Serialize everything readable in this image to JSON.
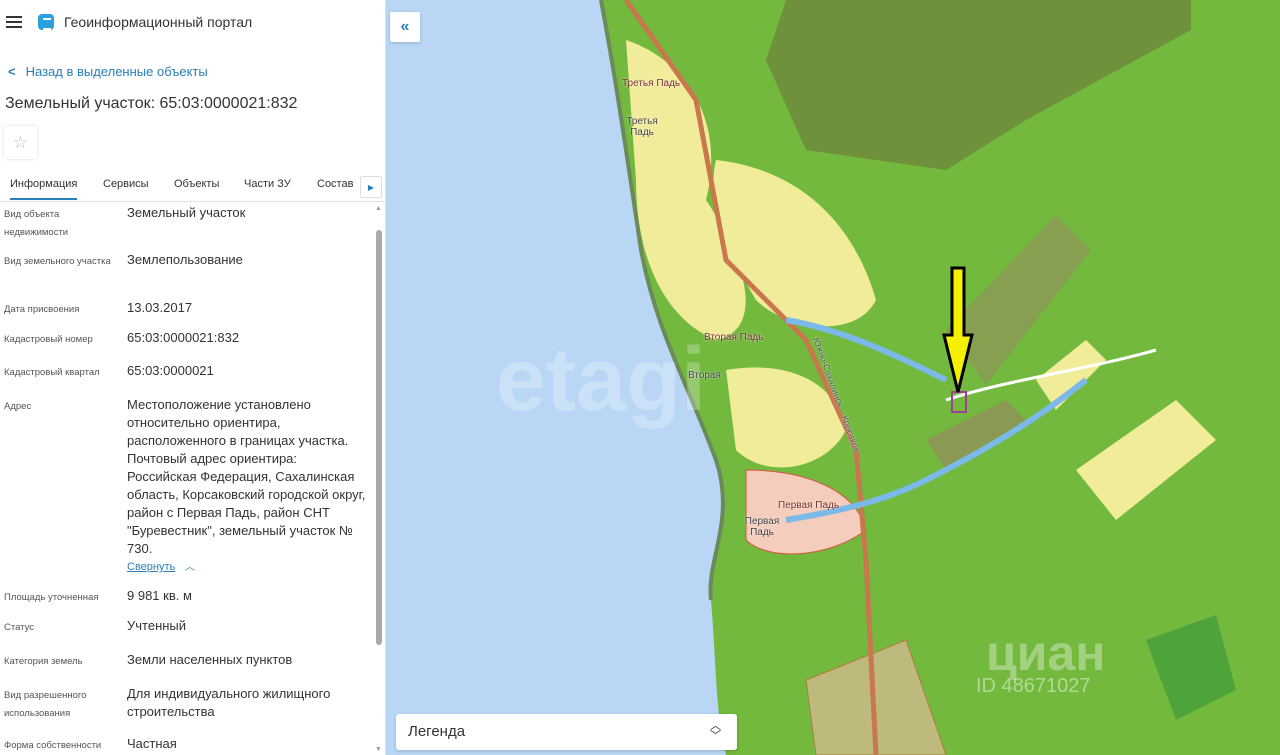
{
  "header": {
    "app_title": "Геоинформационный портал"
  },
  "back_link": "Назад в выделенные объекты",
  "page_title": "Земельный участок: 65:03:0000021:832",
  "tabs": [
    "Информация",
    "Сервисы",
    "Объекты",
    "Части ЗУ",
    "Состав"
  ],
  "fields": [
    {
      "label": "Вид объекта недвижимости",
      "value": "Земельный участок"
    },
    {
      "label": "Вид земельного участка",
      "value": "Землепользование"
    },
    {
      "label": "Дата присвоения",
      "value": "13.03.2017"
    },
    {
      "label": "Кадастровый номер",
      "value": "65:03:0000021:832"
    },
    {
      "label": "Кадастровый квартал",
      "value": "65:03:0000021"
    },
    {
      "label": "Адрес",
      "value": "Местоположение установлено относительно ориентира, расположенного в границах участка. Почтовый адрес ориентира: Российская Федерация, Сахалинская область, Корсаковский городской округ, район с Первая Падь, район СНТ \"Буревестник\", земельный участок № 730."
    },
    {
      "label": "Площадь уточненная",
      "value": "9 981 кв. м"
    },
    {
      "label": "Статус",
      "value": "Учтенный"
    },
    {
      "label": "Категория земель",
      "value": "Земли населенных пунктов"
    },
    {
      "label": "Вид разрешенного использования",
      "value": "Для индивидуального жилищного строительства"
    },
    {
      "label": "Форма собственности",
      "value": "Частная"
    }
  ],
  "collapse_link": "Свернуть",
  "legend_label": "Легенда",
  "map": {
    "labels": [
      "Третья Падь",
      "Третья Падь",
      "Вторая Падь",
      "Вторая",
      "Первая Падь",
      "Первая Падь",
      "Южно-Сахалинск – Корсаков"
    ],
    "watermarks": [
      "etagi",
      "циан",
      "ID 48671027"
    ]
  },
  "colors": {
    "accent": "#2a7fb8",
    "water": "#b9d7f5",
    "forest": "#72b93e",
    "residential": "#f1ec9a",
    "arrow": "#f5ef00"
  }
}
